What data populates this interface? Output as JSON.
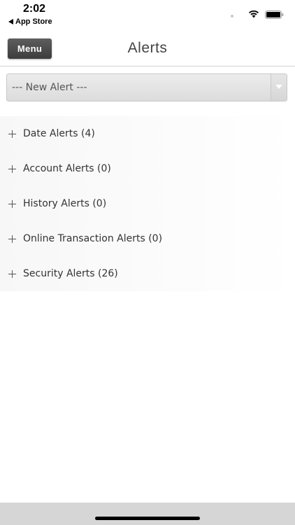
{
  "status_bar": {
    "time": "2:02",
    "back_label": "App Store",
    "icons": [
      "signal-dot-icon",
      "wifi-icon",
      "battery-icon"
    ]
  },
  "header": {
    "menu_label": "Menu",
    "title": "Alerts"
  },
  "new_alert_select": {
    "selected": "--- New Alert ---"
  },
  "alerts": [
    {
      "label": "Date Alerts (4)"
    },
    {
      "label": "Account Alerts (0)"
    },
    {
      "label": "History Alerts (0)"
    },
    {
      "label": "Online Transaction Alerts (0)"
    },
    {
      "label": "Security Alerts (26)"
    }
  ],
  "colors": {
    "menu_button": "#4a4a4a",
    "title_text": "#444444",
    "row_background": "#f7f7f7",
    "bottom_bar": "#d6d6d6"
  }
}
